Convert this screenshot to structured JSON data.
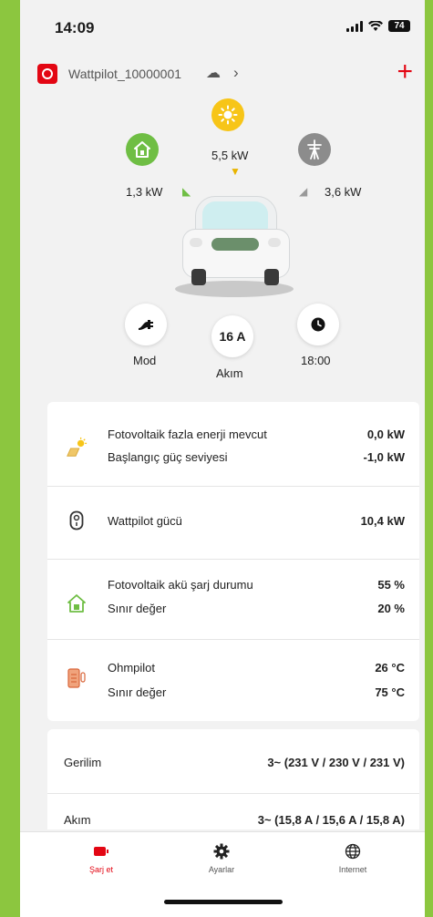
{
  "status_bar": {
    "time": "14:09",
    "battery": "74"
  },
  "header": {
    "device_name": "Wattpilot_10000001"
  },
  "energy_flow": {
    "sun_power": "5,5 kW",
    "home_power": "1,3 kW",
    "grid_power": "3,6 kW"
  },
  "controls": {
    "mode_label": "Mod",
    "current_value": "16 A",
    "current_label": "Akım",
    "time_label": "18:00"
  },
  "info": {
    "pv_surplus_label": "Fotovoltaik fazla enerji mevcut",
    "pv_surplus_value": "0,0 kW",
    "start_power_label": "Başlangıç güç seviyesi",
    "start_power_value": "-1,0 kW",
    "wattpilot_power_label": "Wattpilot gücü",
    "wattpilot_power_value": "10,4 kW",
    "battery_soc_label": "Fotovoltaik akü şarj durumu",
    "battery_soc_value": "55 %",
    "battery_limit_label": "Sınır değer",
    "battery_limit_value": "20 %",
    "ohmpilot_label": "Ohmpilot",
    "ohmpilot_value": "26 °C",
    "ohmpilot_limit_label": "Sınır değer",
    "ohmpilot_limit_value": "75 °C"
  },
  "electrical": {
    "voltage_label": "Gerilim",
    "voltage_value": "3~ (231 V / 230 V / 231 V)",
    "current_label": "Akım",
    "current_value": "3~ (15,8 A / 15,6 A / 15,8 A)"
  },
  "tabs": [
    {
      "label": "Şarj et",
      "icon": "battery-charge-icon",
      "active": true
    },
    {
      "label": "Ayarlar",
      "icon": "gear-icon",
      "active": false
    },
    {
      "label": "Internet",
      "icon": "globe-icon",
      "active": false
    }
  ],
  "colors": {
    "accent": "#e30613",
    "home": "#6fbe44",
    "sun": "#f7c518",
    "grid": "#8c8c8c",
    "frame": "#8cc63f"
  }
}
